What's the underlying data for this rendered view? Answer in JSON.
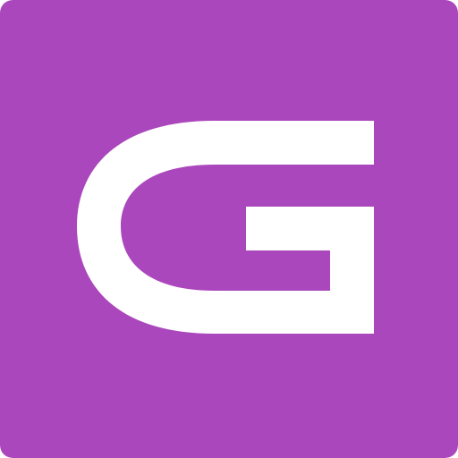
{
  "icon": {
    "semantic": "letter-g-logo-icon",
    "logo_letter": "G",
    "background_color": "#AB47BC",
    "glyph_color": "#FFFFFF"
  }
}
